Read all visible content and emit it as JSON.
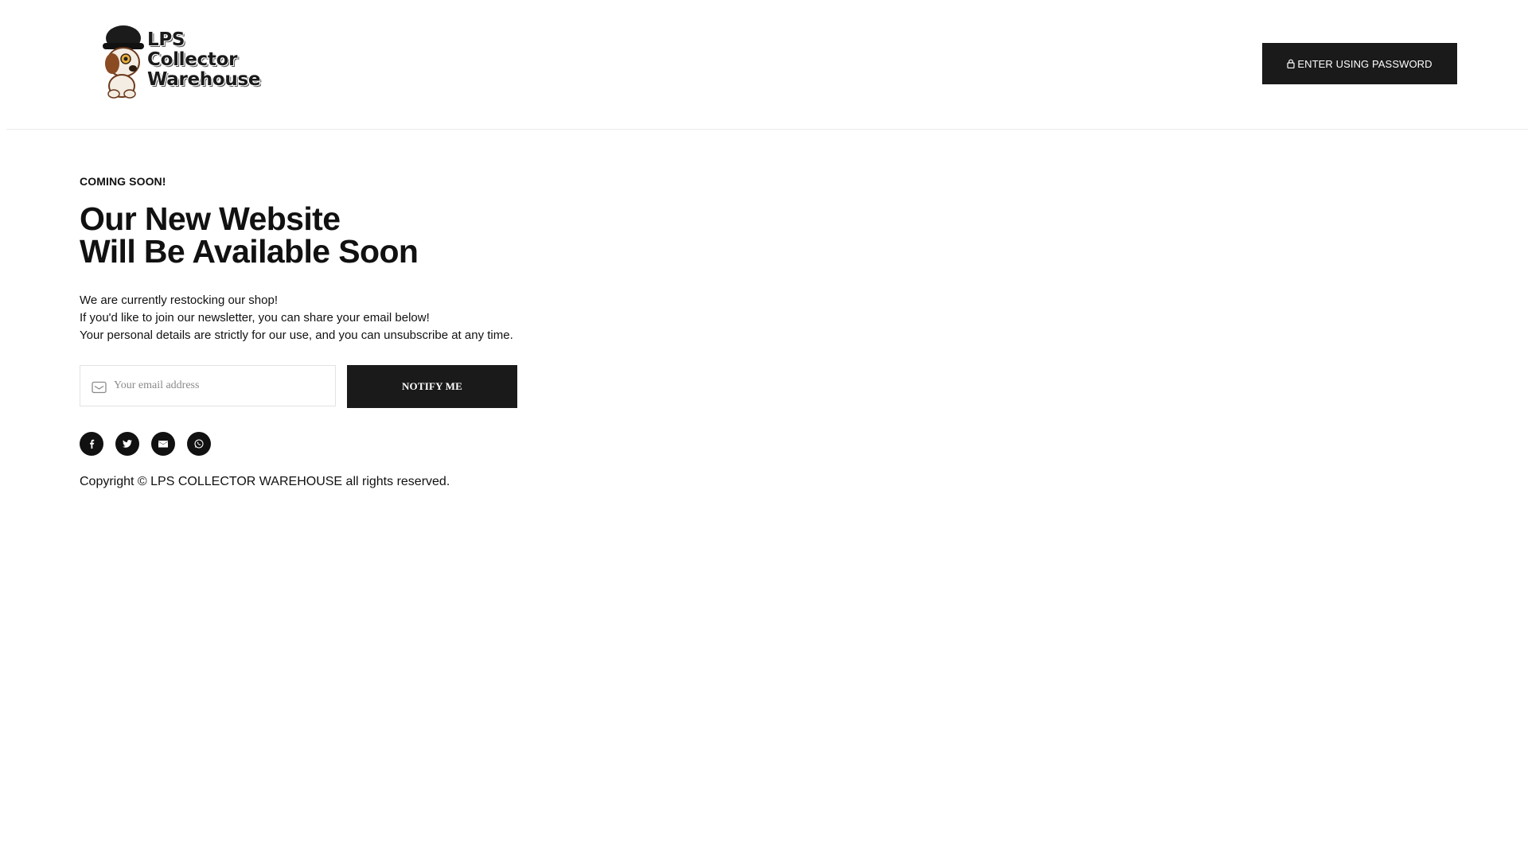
{
  "header": {
    "logo": {
      "alt": "LPS Collector Warehouse",
      "lines": [
        "LPS",
        "Collector",
        "Warehouse"
      ]
    },
    "password_button": {
      "icon": "lock-icon",
      "label": "ENTER USING PASSWORD"
    }
  },
  "main": {
    "eyebrow": "COMING SOON!",
    "headline": [
      "Our New Website",
      "Will Be Available Soon"
    ],
    "description": [
      "We are currently restocking our shop!",
      "If you'd like to join our newsletter, you can share your email below!",
      "Your personal details are strictly for our use, and you can unsubscribe at any time."
    ],
    "form": {
      "email_icon": "mail-icon",
      "email_placeholder": "Your email address",
      "email_value": "",
      "submit_label": "NOTIFY ME"
    },
    "socials": [
      {
        "icon": "facebook-icon"
      },
      {
        "icon": "twitter-icon"
      },
      {
        "icon": "email-icon"
      },
      {
        "icon": "whatsapp-icon"
      }
    ],
    "copyright": "Copyright © LPS COLLECTOR WAREHOUSE all rights reserved."
  },
  "colors": {
    "button_bg": "#1a1a1a",
    "text": "#111111",
    "border": "#e2e2e2",
    "background": "#ffffff"
  }
}
